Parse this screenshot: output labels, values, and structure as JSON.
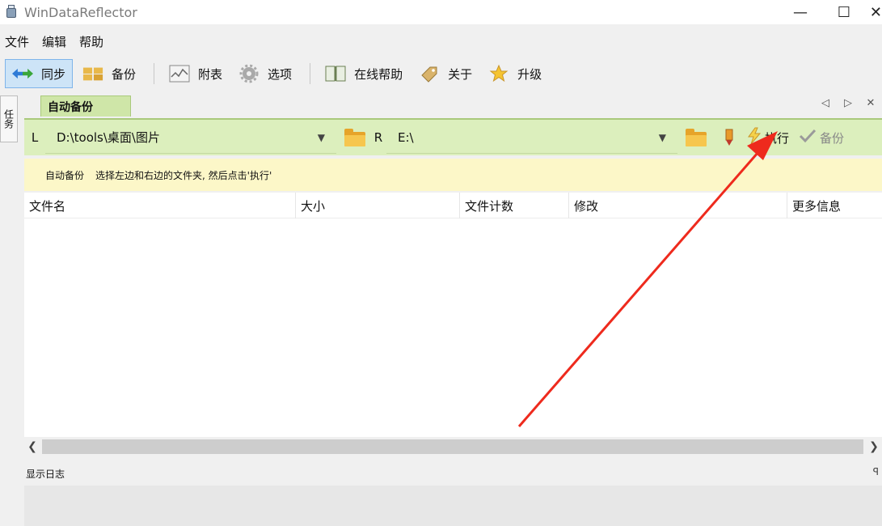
{
  "window": {
    "title": "WinDataReflector",
    "minimize": "—",
    "maximize": "☐",
    "close": "✕"
  },
  "menu": [
    "文件",
    "编辑",
    "帮助"
  ],
  "toolbar": {
    "sync": "同步",
    "backup": "备份",
    "attach": "附表",
    "options": "选项",
    "online_help": "在线帮助",
    "about": "关于",
    "upgrade": "升级"
  },
  "left_dock": {
    "label": "任务"
  },
  "tab": {
    "label": "自动备份",
    "prev": "◁",
    "next": "▷",
    "close": "✕"
  },
  "pathbar": {
    "left_label": "L",
    "left_path": "D:\\tools\\桌面\\图片",
    "right_label": "R",
    "right_path": "E:\\",
    "execute": "执行",
    "backup": "备份"
  },
  "hint": {
    "title": "自动备份",
    "text": "选择左边和右边的文件夹, 然后点击'执行'"
  },
  "columns": [
    "文件名",
    "大小",
    "文件计数",
    "修改",
    "更多信息"
  ],
  "log": {
    "label": "显示日志",
    "pin": "ꟼ"
  },
  "colors": {
    "accent_green": "#dcefbd",
    "hint_yellow": "#fcf7c8",
    "annotation_red": "#ee2a1d"
  }
}
